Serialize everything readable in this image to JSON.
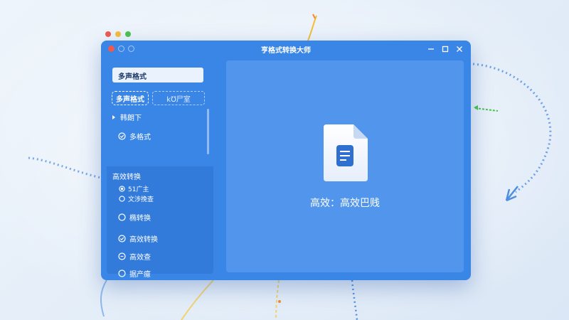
{
  "window": {
    "title": "亨格式转换大师",
    "controls": [
      "minimize-icon",
      "maximize-icon",
      "close-icon"
    ]
  },
  "sidebar": {
    "search_text": "多声格式",
    "mode_tabs": [
      {
        "label": "多声格式",
        "active": true
      },
      {
        "label": "k℧尸室",
        "active": false
      }
    ],
    "items": [
      {
        "label": "韩朗下",
        "icon": "chevron-right-icon"
      },
      {
        "label": "多格式",
        "icon": "check-circle-icon"
      }
    ],
    "group": {
      "title": "高效转换",
      "sub_items": [
        {
          "label": "51广主",
          "icon": "radio-selected-icon"
        },
        {
          "label": "文涉挽查",
          "icon": "radio-icon"
        }
      ],
      "items": [
        {
          "label": "椭转换",
          "icon": "circle-icon"
        },
        {
          "label": "高效转换",
          "icon": "check-circle-icon"
        },
        {
          "label": "高效查",
          "icon": "circle-dot-icon"
        },
        {
          "label": "据产癔",
          "icon": "circle-icon"
        }
      ]
    }
  },
  "main": {
    "caption": "高效：高效巴贱",
    "icon": "document-icon"
  },
  "colors": {
    "window_bg": "#3a86e6",
    "main_panel": "#5196ec",
    "close_red": "#ee5a4f",
    "ghost_yellow": "#f4bd3a",
    "ghost_green": "#4cc24f"
  }
}
